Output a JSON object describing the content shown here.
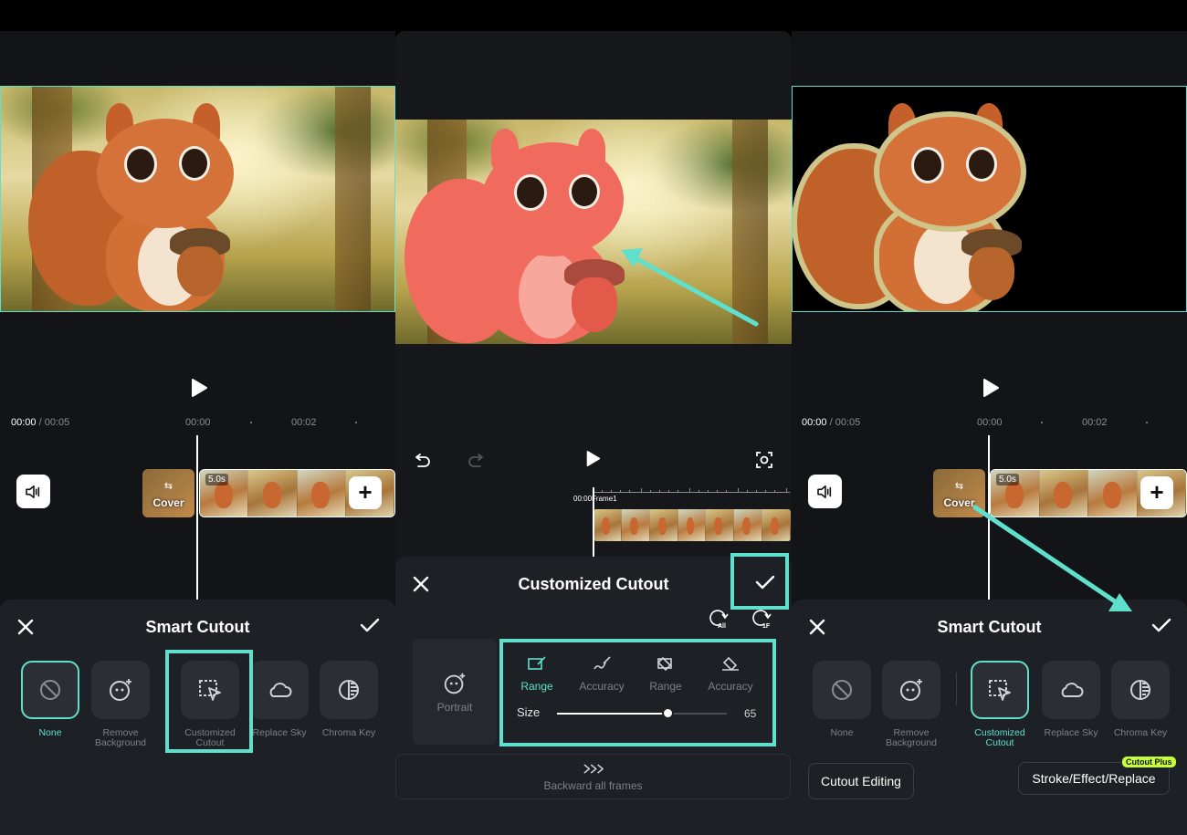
{
  "panel1": {
    "time_current": "00:00",
    "time_total": "/ 00:05",
    "ruler": [
      "00:00",
      "00:02"
    ],
    "cover_label": "Cover",
    "clip_duration": "5.0s",
    "sheet_title": "Smart Cutout",
    "options": [
      {
        "label": "None",
        "icon": "none-icon",
        "selected": true
      },
      {
        "label": "Remove\nBackground",
        "icon": "remove-background-icon",
        "selected": false
      },
      {
        "label": "Customized\nCutout",
        "icon": "customized-cutout-icon",
        "selected": false
      },
      {
        "label": "Replace Sky",
        "icon": "cloud-icon",
        "selected": false
      },
      {
        "label": "Chroma Key",
        "icon": "chroma-key-icon",
        "selected": false
      }
    ]
  },
  "panel2": {
    "frame_time": "00:00",
    "frame_label": "Frame1",
    "sheet_title": "Customized Cutout",
    "apply_all_label": "All",
    "apply_frame_label": "1F",
    "portrait_label": "Portrait",
    "modes": [
      {
        "label": "Range",
        "icon": "brush-add-icon",
        "active": true
      },
      {
        "label": "Accuracy",
        "icon": "pen-icon",
        "active": false
      },
      {
        "label": "Range",
        "icon": "eraser-icon",
        "active": false
      },
      {
        "label": "Accuracy",
        "icon": "eraser-fine-icon",
        "active": false
      }
    ],
    "size_label": "Size",
    "size_value": "65",
    "size_fraction": 0.65,
    "backward_label": "Backward all frames"
  },
  "panel3": {
    "time_current": "00:00",
    "time_total": "/ 00:05",
    "ruler": [
      "00:00",
      "00:02"
    ],
    "cover_label": "Cover",
    "clip_duration": "5.0s",
    "sheet_title": "Smart Cutout",
    "options": [
      {
        "label": "None",
        "icon": "none-icon",
        "selected": false
      },
      {
        "label": "Remove\nBackground",
        "icon": "remove-background-icon",
        "selected": false
      },
      {
        "label": "Customized\nCutout",
        "icon": "customized-cutout-icon",
        "selected": true
      },
      {
        "label": "Replace Sky",
        "icon": "cloud-icon",
        "selected": false
      },
      {
        "label": "Chroma Key",
        "icon": "chroma-key-icon",
        "selected": false
      }
    ],
    "cutout_editing_label": "Cutout Editing",
    "stroke_label": "Stroke/Effect/Replace",
    "badge_label": "Cutout Plus"
  },
  "colors": {
    "accent": "#5fe0cc",
    "badge": "#c6ff3a",
    "sheet_bg": "#1d2024",
    "panel_bg": "#121417"
  }
}
